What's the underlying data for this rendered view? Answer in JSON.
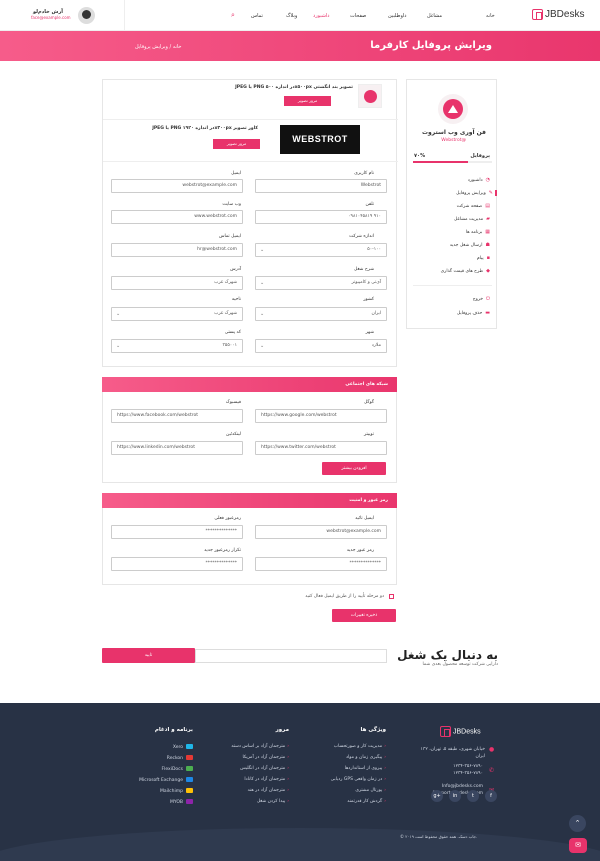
{
  "header": {
    "logo": "JBDesks",
    "nav": [
      "خانه",
      "مشاغل",
      "داوطلبین",
      "صفحات",
      "داشبورد",
      "وبلاگ",
      "تماس"
    ],
    "user_name": "آرش خادم‌لو",
    "user_email": "face@example.com"
  },
  "banner": {
    "title": "ویرایش پروفایل کارفرما",
    "breadcrumb": "خانه / ویرایش پروفایل"
  },
  "sidebar": {
    "company": "فن آوری وب استروت",
    "site": "Webstrot@",
    "profile_label": "پروفایل",
    "percent": "۷۰%",
    "progress": 0.7,
    "items": [
      {
        "label": "داشبورد",
        "icon": "dashboard-icon"
      },
      {
        "label": "ویرایش پروفایل",
        "icon": "edit-icon"
      },
      {
        "label": "صفحه شرکت",
        "icon": "company-icon"
      },
      {
        "label": "مدیریت مشاغل",
        "icon": "briefcase-icon"
      },
      {
        "label": "برنامه ها",
        "icon": "apps-icon"
      },
      {
        "label": "ارسال شغل جدید",
        "icon": "add-user-icon"
      },
      {
        "label": "پیام",
        "icon": "message-icon"
      },
      {
        "label": "طرح های قیمت گذاری",
        "icon": "tag-icon"
      }
    ],
    "logout": "خروج",
    "delete": "حذف پروفایل"
  },
  "uploads": {
    "logo_text": "JPEG یا PNG در اندازه ۵۰۰x۵۰۰px تصویر بند انگشتی",
    "cover_text": "JPEG یا PNG در اندازه ۱۹۲۰x۳۰۰px کاور تصویر",
    "browse": "مرور تصویر",
    "cover_brand": "WEBSTROT"
  },
  "form": {
    "username_label": "نام کاربری",
    "username": "Webstrot",
    "email_label": "ایمیل",
    "email": "webstrot@example.com",
    "phone_label": "تلفن",
    "phone": "۰۹۸۱۰۴۵۸۱۹ ۹۱۰",
    "website_label": "وب سایت",
    "website": "www.webstrot.com",
    "size_label": "اندازه شرکت",
    "size": "۵۰-۱۰۰",
    "contact_email_label": "ایمیل تماس",
    "contact_email": "hr@webstrot.com",
    "category_label": "شرح شغل",
    "category": "آی‌تی و کامپیوتر",
    "address_label": "آدرس",
    "address": "شهرک غرب",
    "country_label": "کشور",
    "country": "ایران",
    "region_label": "ناحیه",
    "region": "شهرک غرب",
    "city_label": "شهر",
    "city": "ملارد",
    "zip_label": "کد پستی",
    "zip": "۳۵۵۰۰۱"
  },
  "social": {
    "header": "شبکه های اجتماعی",
    "google_label": "گوگل",
    "google": "https://www.google.com/webstrot",
    "facebook_label": "فیسبوک",
    "facebook": "https://www.facebook.com/webstrot",
    "twitter_label": "توییتر",
    "twitter": "https://www.twitter.com/webstrot",
    "linkedin_label": "لینکدئین",
    "linkedin": "https://www.linkedin.com/webstrot",
    "add_more": "افزودن بیشتر"
  },
  "security": {
    "header": "رمز عبور و امنیت",
    "confirm_email_label": "ایمیل تائید",
    "confirm_email": "webstrot@example.com",
    "current_pw_label": "رمزعبور فعلی",
    "current_pw": "**************",
    "new_pw_label": "رمز عبور جدید",
    "new_pw": "**************",
    "repeat_pw_label": "تکرار رمزعبور جدید",
    "repeat_pw": "**************",
    "two_step": "دو مرحله تأیید را از طریق ایمیل فعال کنید",
    "save": "ذخیره تغییرات"
  },
  "job": {
    "title": "به دنبال یک شغل",
    "subtitle": "دارایی شرکت توسعه محصول بعدی شما",
    "confirm": "تایید"
  },
  "footer": {
    "logo": "JBDesks",
    "address": "۱۳۲ خیابان شهری، طبقه ۵، تهران، ایران",
    "phones": [
      "۱۲۳۴-۳۵۶-۷۸۹۰",
      "۱۲۳۴-۳۵۶-۷۸۹۰"
    ],
    "emails": [
      "Info@jbdesks.com",
      "Support@jbdesks.com"
    ],
    "features_h": "ویژگی ها",
    "features": [
      "مدیریت کار و صورتحساب",
      "پیگیری زمان و مواد",
      "پیروی از استانداردها",
      "ردیابی GPS در زمان واقعی",
      "پورتال مشتری",
      "گردش کار قدرتمند"
    ],
    "browse_h": "مرور",
    "browse": [
      "مترجمان آزاد بر اساس دسته",
      "مترجمان آزاد در آمریکا",
      "مترجمان آزاد در انگلیس",
      "مترجمان آزاد در کانادا",
      "مترجمان آزاد در هند",
      "پیدا کردن شغل"
    ],
    "apps_h": "برنامه و ادغام",
    "apps": [
      {
        "name": "Xero",
        "color": "#1fb6e8"
      },
      {
        "name": "Reckon",
        "color": "#e53935"
      },
      {
        "name": "FlexiDocs",
        "color": "#4caf50"
      },
      {
        "name": "Microsoft Exchange",
        "color": "#1e88e5"
      },
      {
        "name": "Mailchimp",
        "color": "#ffc107"
      },
      {
        "name": "MYOB",
        "color": "#8e24aa"
      }
    ],
    "copyright": "© ۲۰۱۹ جاب دسک. همه حقوق محفوظ است."
  }
}
